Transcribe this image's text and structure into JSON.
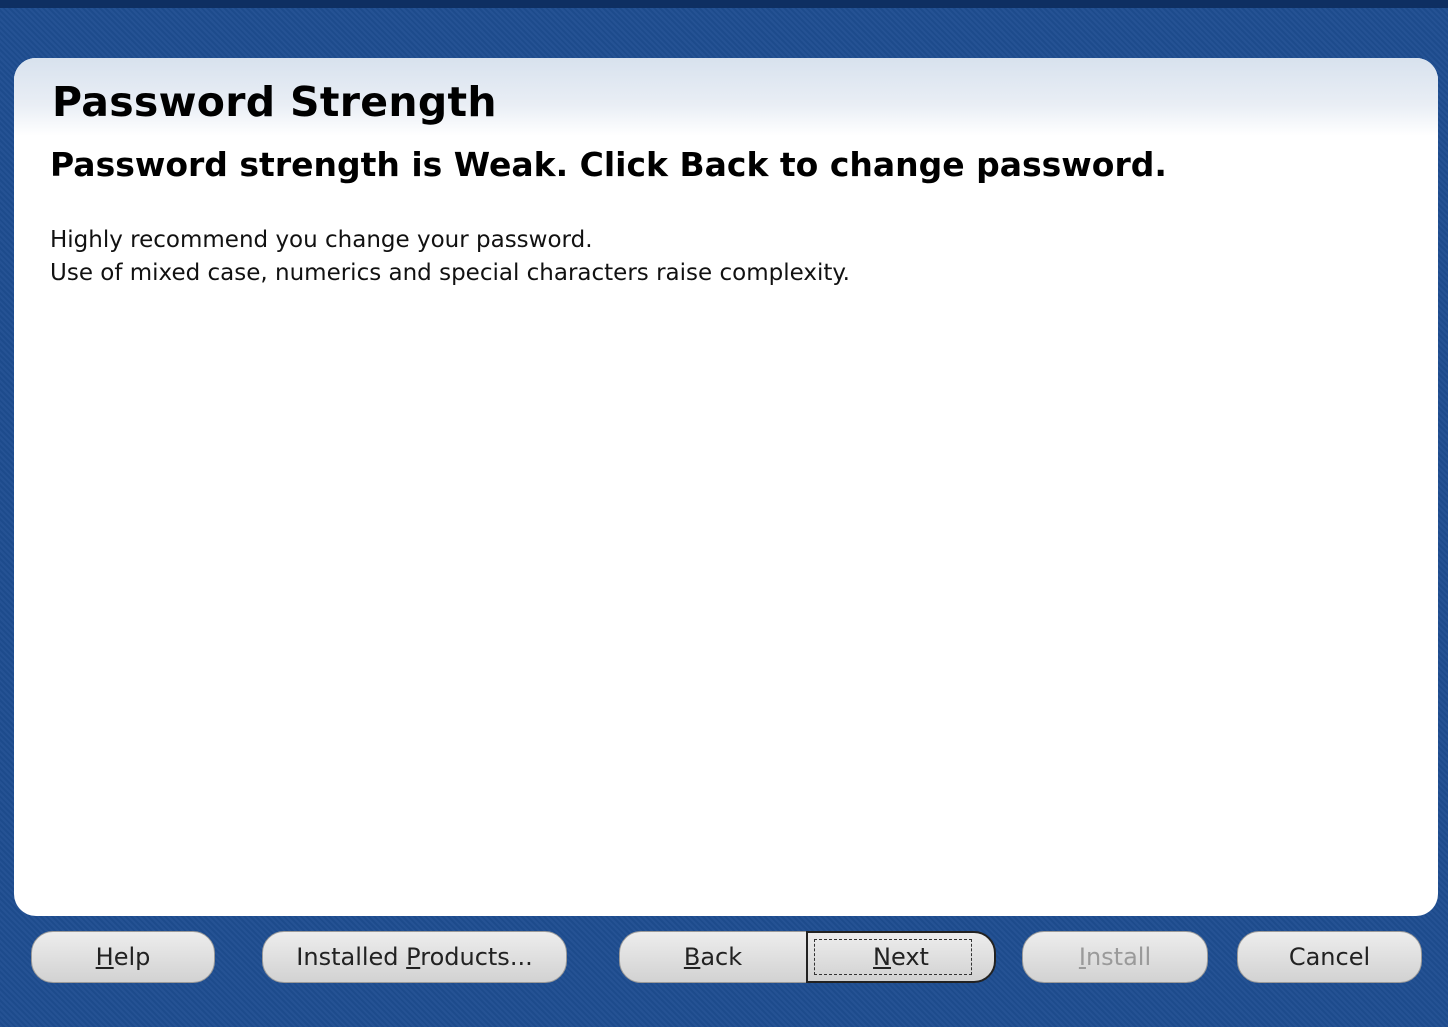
{
  "header": {
    "title": "Password Strength"
  },
  "message": {
    "headline": "Password strength is Weak.  Click  Back to change password.",
    "lines": [
      "Highly recommend you change your password.",
      "Use of mixed case, numerics and special characters raise complexity."
    ]
  },
  "buttons": {
    "help": {
      "pre": "",
      "mnemonic": "H",
      "post": "elp"
    },
    "installed_products": {
      "pre": "Installed ",
      "mnemonic": "P",
      "post": "roducts..."
    },
    "back": {
      "pre": "",
      "mnemonic": "B",
      "post": "ack"
    },
    "next": {
      "pre": "",
      "mnemonic": "N",
      "post": "ext"
    },
    "install": {
      "pre": "",
      "mnemonic": "I",
      "post": "nstall",
      "enabled": false
    },
    "cancel": {
      "pre": "",
      "mnemonic": "",
      "post": "Cancel"
    }
  },
  "colors": {
    "frame": "#1e4d91",
    "panel": "#ffffff",
    "button": "#dcdcdc",
    "disabled_text": "#9a9a9a"
  }
}
